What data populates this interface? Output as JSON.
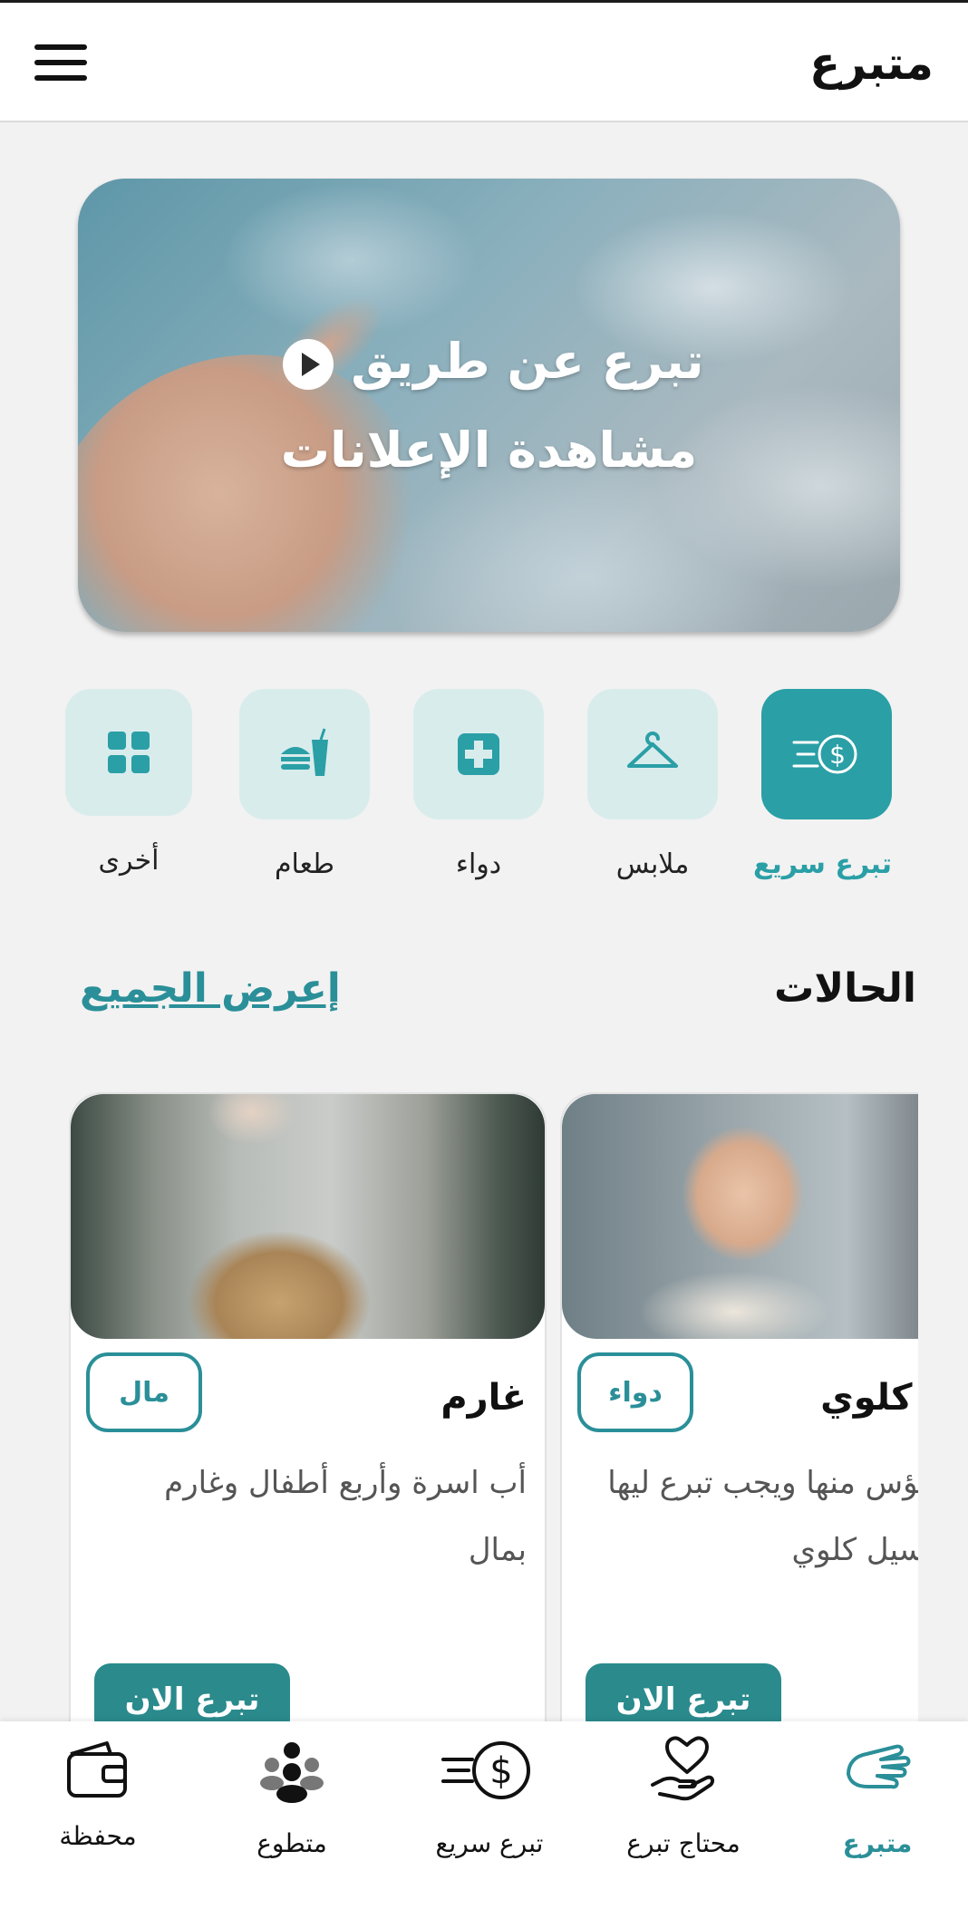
{
  "app": {
    "title": "متبرع"
  },
  "banner": {
    "line1": "تبرع عن طريق",
    "line2": "مشاهدة الإعلانات"
  },
  "categories": [
    {
      "label": "تبرع سريع",
      "icon": "quick-donate-icon",
      "active": true
    },
    {
      "label": "ملابس",
      "icon": "hanger-icon",
      "active": false
    },
    {
      "label": "دواء",
      "icon": "medical-cross-icon",
      "active": false
    },
    {
      "label": "طعام",
      "icon": "food-icon",
      "active": false
    },
    {
      "label": "أخرى",
      "icon": "grid-icon",
      "active": false
    }
  ],
  "cases": {
    "title": "الحالات",
    "view_all": "إعرض الجميع",
    "items": [
      {
        "name": "غارم",
        "badge": "مال",
        "description": "أب اسرة وأربع أطفال وغارم بمال",
        "button": "تبرع الان"
      },
      {
        "name": "فشل كلوي",
        "badge": "دواء",
        "description": "طفل ميؤس منها ويجب تبرع ليها لعمل غسيل كلوي",
        "button": "تبرع الان"
      }
    ]
  },
  "bottom_nav": [
    {
      "label": "محفظة",
      "icon": "wallet-icon",
      "active": false
    },
    {
      "label": "متطوع",
      "icon": "volunteers-icon",
      "active": false
    },
    {
      "label": "تبرع سريع",
      "icon": "quick-donate-icon",
      "active": false
    },
    {
      "label": "محتاج تبرع",
      "icon": "heart-hand-icon",
      "active": false
    },
    {
      "label": "متبرع",
      "icon": "donor-hand-icon",
      "active": true
    }
  ],
  "colors": {
    "accent": "#2a9fa6",
    "accent_dark": "#2a8a8c",
    "tile": "#d9ecec"
  }
}
